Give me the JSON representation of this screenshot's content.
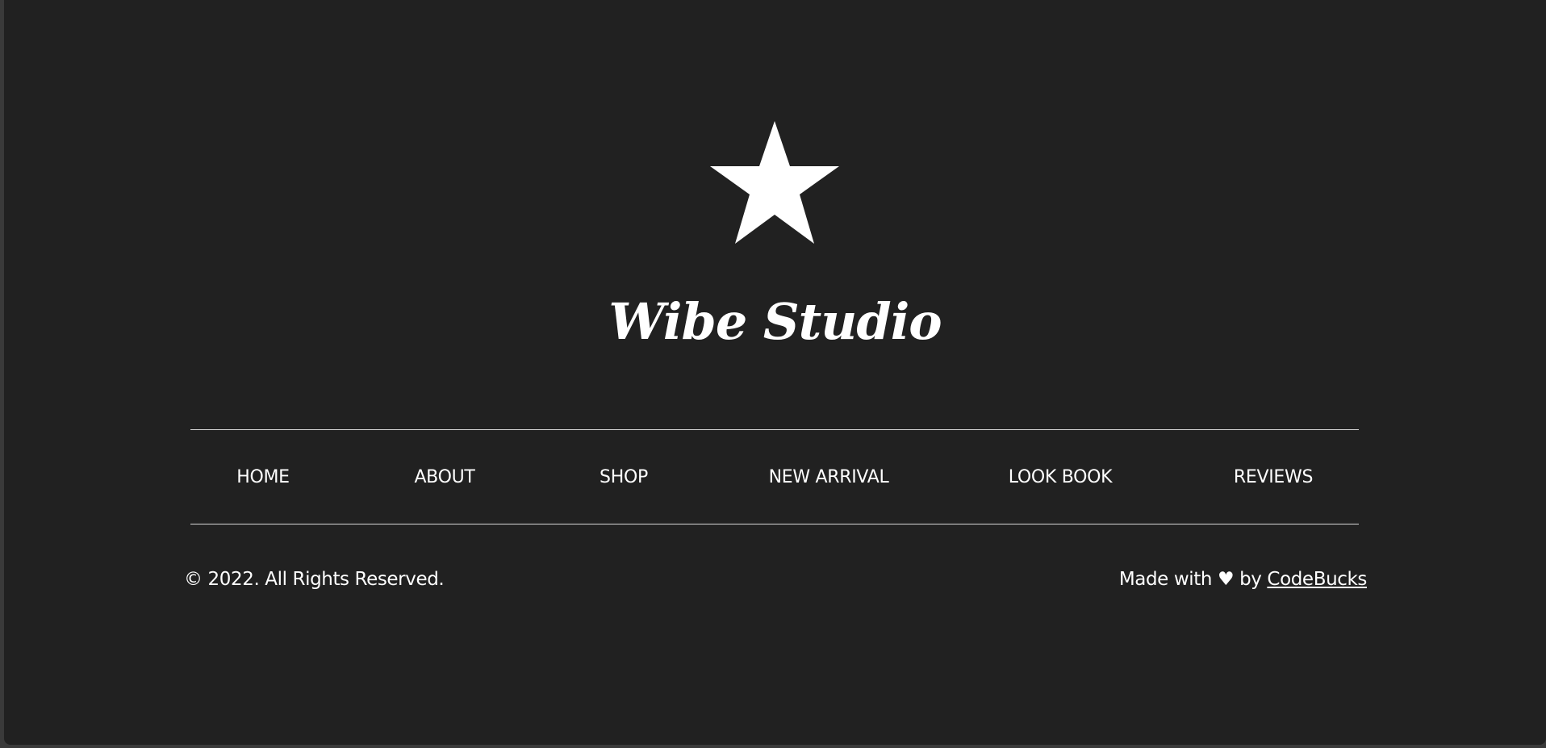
{
  "brand": {
    "logo_icon": "star-icon",
    "name": "Wibe Studio"
  },
  "nav": {
    "items": [
      {
        "label": "HOME"
      },
      {
        "label": "ABOUT"
      },
      {
        "label": "SHOP"
      },
      {
        "label": "NEW ARRIVAL"
      },
      {
        "label": "LOOK BOOK"
      },
      {
        "label": "REVIEWS"
      }
    ]
  },
  "footer": {
    "copyright": "© 2022. All Rights Reserved.",
    "credit_prefix": "Made with ♥ by ",
    "credit_link": "CodeBucks"
  },
  "colors": {
    "background": "#212121",
    "text": "#ffffff",
    "divider": "#d8d8d8"
  }
}
